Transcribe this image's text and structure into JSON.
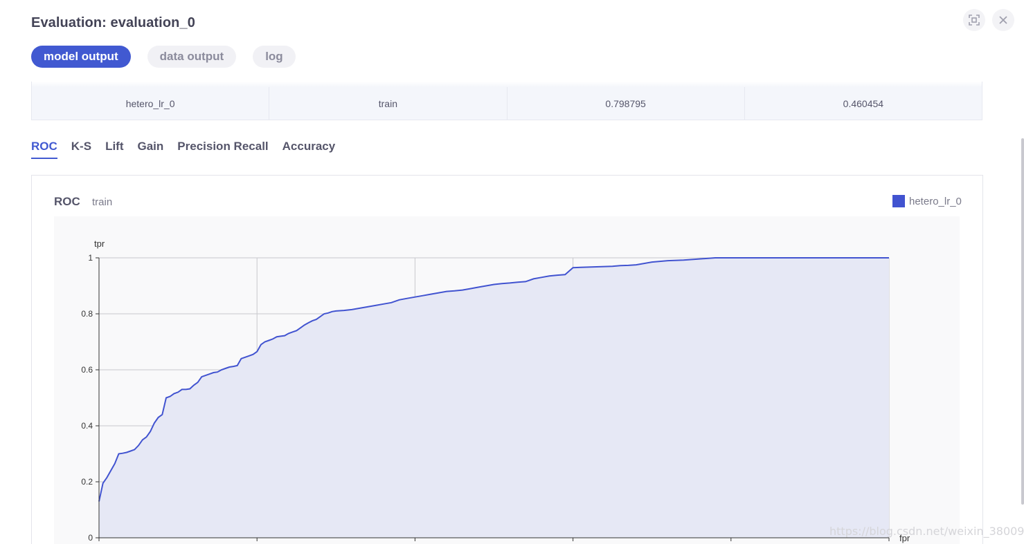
{
  "header": {
    "title": "Evaluation: evaluation_0"
  },
  "tabs": [
    {
      "label": "model output",
      "active": true
    },
    {
      "label": "data output",
      "active": false
    },
    {
      "label": "log",
      "active": false
    }
  ],
  "table": {
    "row": [
      "hetero_lr_0",
      "train",
      "0.798795",
      "0.460454"
    ]
  },
  "metric_tabs": [
    {
      "label": "ROC",
      "active": true
    },
    {
      "label": "K-S",
      "active": false
    },
    {
      "label": "Lift",
      "active": false
    },
    {
      "label": "Gain",
      "active": false
    },
    {
      "label": "Precision Recall",
      "active": false
    },
    {
      "label": "Accuracy",
      "active": false
    }
  ],
  "icons": {
    "maximize": "maximize-icon",
    "close": "close-icon"
  },
  "colors": {
    "accent": "#4159d1",
    "series": "#4153d0",
    "area_fill": "#e6e8f5"
  },
  "watermark": "https://blog.csdn.net/weixin_38009252",
  "chart_data": {
    "type": "area",
    "title": "ROC",
    "subtitle": "train",
    "xlabel": "fpr",
    "ylabel": "tpr",
    "ylim": [
      0,
      1
    ],
    "xlim": [
      0,
      1
    ],
    "yticks": [
      "1",
      "0.8",
      "0.6",
      "0.4",
      "0.2",
      "0"
    ],
    "grid": true,
    "legend_position": "top-right",
    "series": [
      {
        "name": "hetero_lr_0",
        "x": [
          0,
          0.005,
          0.01,
          0.015,
          0.02,
          0.025,
          0.03,
          0.035,
          0.04,
          0.045,
          0.05,
          0.055,
          0.06,
          0.065,
          0.07,
          0.075,
          0.08,
          0.085,
          0.09,
          0.095,
          0.1,
          0.105,
          0.11,
          0.115,
          0.12,
          0.125,
          0.13,
          0.135,
          0.14,
          0.145,
          0.15,
          0.155,
          0.16,
          0.165,
          0.17,
          0.175,
          0.18,
          0.185,
          0.19,
          0.195,
          0.2,
          0.205,
          0.21,
          0.215,
          0.22,
          0.225,
          0.23,
          0.235,
          0.24,
          0.245,
          0.25,
          0.255,
          0.26,
          0.265,
          0.27,
          0.275,
          0.28,
          0.285,
          0.29,
          0.295,
          0.3,
          0.31,
          0.32,
          0.33,
          0.34,
          0.35,
          0.36,
          0.37,
          0.38,
          0.39,
          0.4,
          0.41,
          0.42,
          0.43,
          0.44,
          0.45,
          0.46,
          0.47,
          0.48,
          0.49,
          0.5,
          0.51,
          0.52,
          0.53,
          0.54,
          0.55,
          0.56,
          0.57,
          0.58,
          0.59,
          0.6,
          0.61,
          0.62,
          0.63,
          0.64,
          0.65,
          0.66,
          0.67,
          0.68,
          0.69,
          0.7,
          0.72,
          0.74,
          0.76,
          0.78,
          0.8,
          0.82,
          0.84,
          0.86,
          0.88,
          0.9,
          0.92,
          0.94,
          0.96,
          0.98,
          1.0
        ],
        "y": [
          0.13,
          0.195,
          0.215,
          0.24,
          0.265,
          0.3,
          0.302,
          0.305,
          0.31,
          0.315,
          0.33,
          0.35,
          0.36,
          0.38,
          0.41,
          0.43,
          0.44,
          0.5,
          0.505,
          0.515,
          0.52,
          0.53,
          0.53,
          0.532,
          0.545,
          0.555,
          0.575,
          0.58,
          0.585,
          0.59,
          0.592,
          0.6,
          0.605,
          0.61,
          0.612,
          0.615,
          0.64,
          0.645,
          0.65,
          0.655,
          0.665,
          0.69,
          0.7,
          0.705,
          0.71,
          0.718,
          0.72,
          0.722,
          0.73,
          0.735,
          0.74,
          0.75,
          0.76,
          0.768,
          0.775,
          0.78,
          0.79,
          0.8,
          0.803,
          0.808,
          0.81,
          0.812,
          0.815,
          0.82,
          0.825,
          0.83,
          0.835,
          0.84,
          0.85,
          0.855,
          0.86,
          0.865,
          0.87,
          0.875,
          0.88,
          0.882,
          0.885,
          0.89,
          0.895,
          0.9,
          0.905,
          0.908,
          0.91,
          0.913,
          0.915,
          0.925,
          0.93,
          0.935,
          0.938,
          0.94,
          0.965,
          0.966,
          0.967,
          0.968,
          0.969,
          0.97,
          0.972,
          0.973,
          0.975,
          0.98,
          0.985,
          0.99,
          0.992,
          0.996,
          1.0,
          1.0,
          1.0,
          1.0,
          1.0,
          1.0,
          1.0,
          1.0,
          1.0,
          1.0,
          1.0,
          1.0
        ]
      }
    ]
  }
}
